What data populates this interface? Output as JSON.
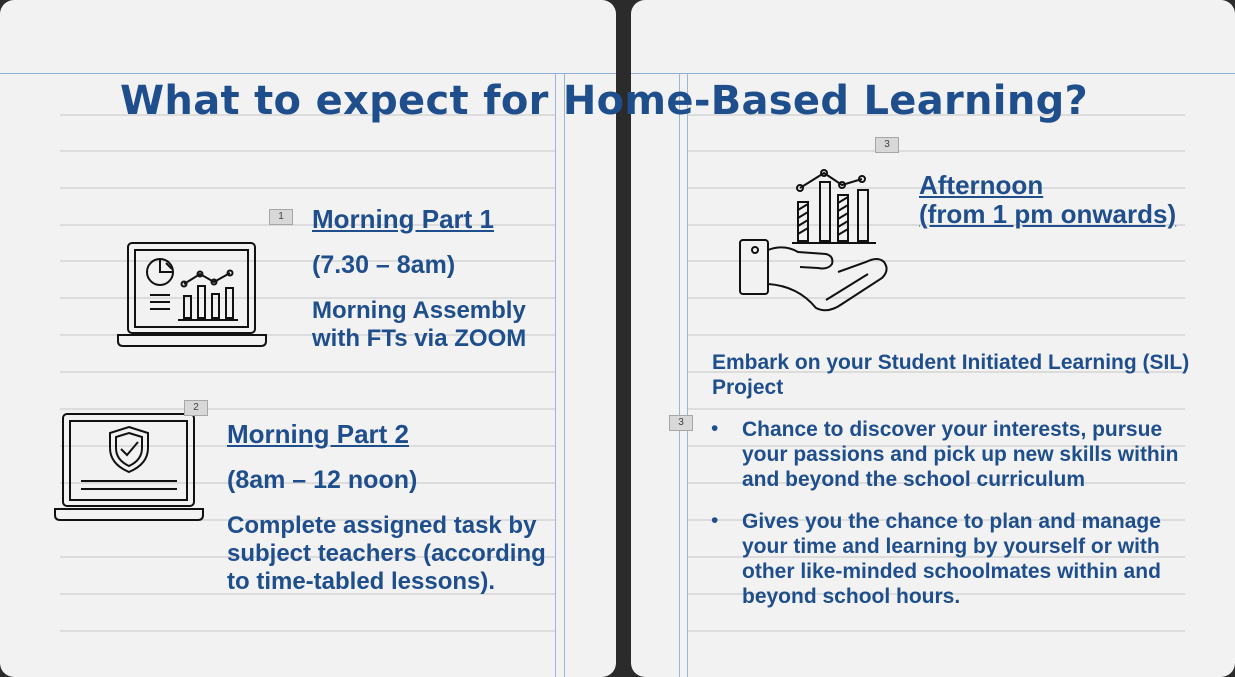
{
  "title": "What to expect for Home-Based Learning?",
  "tags": {
    "t1": "1",
    "t2": "2",
    "t3a": "3",
    "t3b": "3"
  },
  "morning1": {
    "heading": "Morning Part 1",
    "time": "(7.30 – 8am)",
    "desc": "Morning Assembly with FTs via ZOOM"
  },
  "morning2": {
    "heading": "Morning Part 2",
    "time": "(8am – 12 noon)",
    "desc": "Complete assigned task by subject teachers (according to time-tabled lessons)."
  },
  "afternoon": {
    "heading": "Afternoon",
    "time": "(from 1 pm onwards)",
    "intro": "Embark on your Student Initiated Learning (SIL) Project",
    "bullets": [
      "Chance to discover your interests, pursue your passions and pick up new skills within and beyond the school curriculum",
      "Gives you the chance to plan and manage your time and learning by yourself or with other like-minded schoolmates within and beyond school hours."
    ]
  },
  "colors": {
    "text": "#1f4e8c",
    "page": "#f2f2f2",
    "background": "#2b2b2b"
  },
  "icons": [
    "laptop-dashboard-icon",
    "laptop-shield-icon",
    "hand-chart-icon"
  ]
}
